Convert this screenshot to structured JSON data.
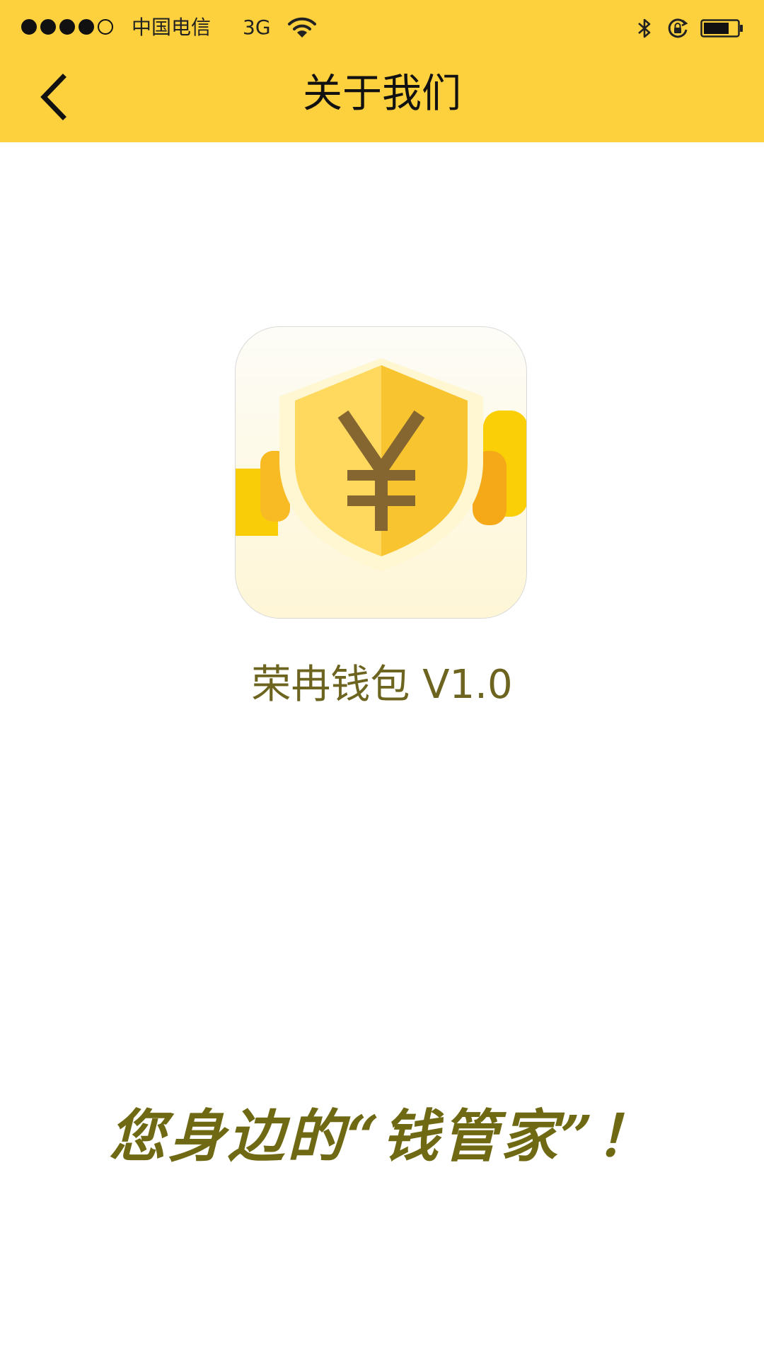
{
  "status_bar": {
    "signal_bars_filled": 4,
    "signal_bars_total": 5,
    "carrier": "中国电信",
    "network": "3G",
    "icons": [
      "wifi-icon",
      "bluetooth-icon",
      "rotation-lock-icon",
      "battery-icon"
    ],
    "battery_level": 0.75
  },
  "nav": {
    "back_icon": "chevron-left-icon",
    "title": "关于我们"
  },
  "app": {
    "icon": "yuan-shield-icon",
    "name": "荣冉钱包 V1.0"
  },
  "slogan": "您身边的“钱管家”！",
  "colors": {
    "header": "#fdd03e",
    "text_brand": "#6d6420",
    "shield_left": "#fed95e",
    "shield_right": "#f8c531",
    "yuan": "#856631"
  }
}
